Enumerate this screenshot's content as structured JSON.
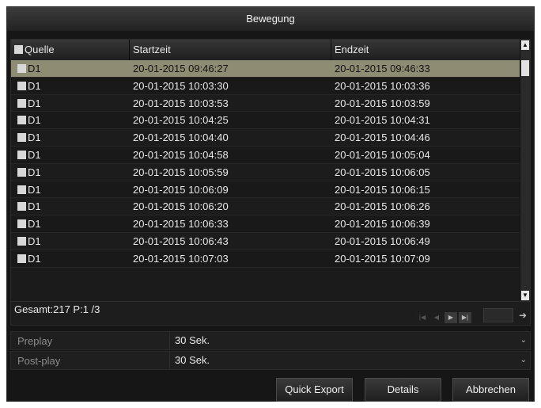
{
  "window": {
    "title": "Bewegung"
  },
  "table": {
    "columns": [
      "Quelle",
      "Startzeit",
      "Endzeit"
    ],
    "rows": [
      {
        "source": "D1",
        "start": "20-01-2015 09:46:27",
        "end": "20-01-2015 09:46:33",
        "selected": true
      },
      {
        "source": "D1",
        "start": "20-01-2015 10:03:30",
        "end": "20-01-2015 10:03:36"
      },
      {
        "source": "D1",
        "start": "20-01-2015 10:03:53",
        "end": "20-01-2015 10:03:59"
      },
      {
        "source": "D1",
        "start": "20-01-2015 10:04:25",
        "end": "20-01-2015 10:04:31"
      },
      {
        "source": "D1",
        "start": "20-01-2015 10:04:40",
        "end": "20-01-2015 10:04:46"
      },
      {
        "source": "D1",
        "start": "20-01-2015 10:04:58",
        "end": "20-01-2015 10:05:04"
      },
      {
        "source": "D1",
        "start": "20-01-2015 10:05:59",
        "end": "20-01-2015 10:06:05"
      },
      {
        "source": "D1",
        "start": "20-01-2015 10:06:09",
        "end": "20-01-2015 10:06:15"
      },
      {
        "source": "D1",
        "start": "20-01-2015 10:06:20",
        "end": "20-01-2015 10:06:26"
      },
      {
        "source": "D1",
        "start": "20-01-2015 10:06:33",
        "end": "20-01-2015 10:06:39"
      },
      {
        "source": "D1",
        "start": "20-01-2015 10:06:43",
        "end": "20-01-2015 10:06:49"
      },
      {
        "source": "D1",
        "start": "20-01-2015 10:07:03",
        "end": "20-01-2015 10:07:09"
      }
    ]
  },
  "pagination": {
    "summary": "Gesamt:217 P:1 /3"
  },
  "settings": [
    {
      "label": "Preplay",
      "value": "30 Sek."
    },
    {
      "label": "Post-play",
      "value": "30 Sek."
    }
  ],
  "buttons": {
    "quick_export": "Quick Export",
    "details": "Details",
    "cancel": "Abbrechen"
  },
  "colors": {
    "selected_row": "#8f8c74",
    "background": "#161616"
  }
}
